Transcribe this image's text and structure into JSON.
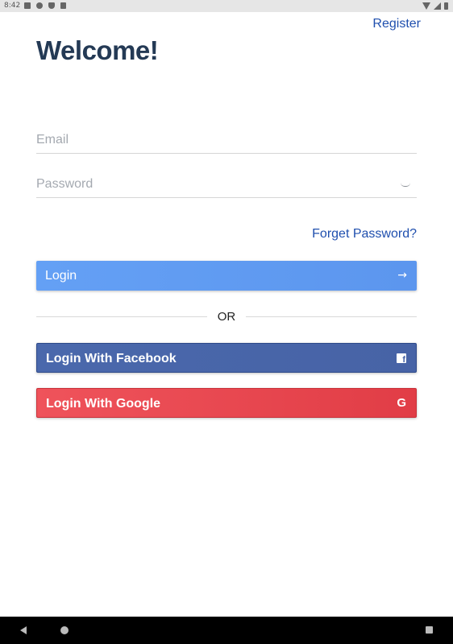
{
  "status_bar": {
    "time": "8:42"
  },
  "header": {
    "register_label": "Register",
    "title": "Welcome!"
  },
  "form": {
    "email": {
      "placeholder": "Email",
      "value": ""
    },
    "password": {
      "placeholder": "Password",
      "value": ""
    },
    "forgot_label": "Forget Password?"
  },
  "buttons": {
    "login": "Login",
    "facebook": "Login With Facebook",
    "google": "Login With Google"
  },
  "divider_label": "OR",
  "colors": {
    "link": "#1f4fae",
    "title": "#243a55",
    "login": "#5c96ee",
    "facebook": "#4763a6",
    "google": "#e13d46"
  },
  "icons": {
    "login": "arrow-right-icon",
    "facebook": "facebook-icon",
    "google": "google-icon",
    "password_toggle": "eye-icon"
  }
}
